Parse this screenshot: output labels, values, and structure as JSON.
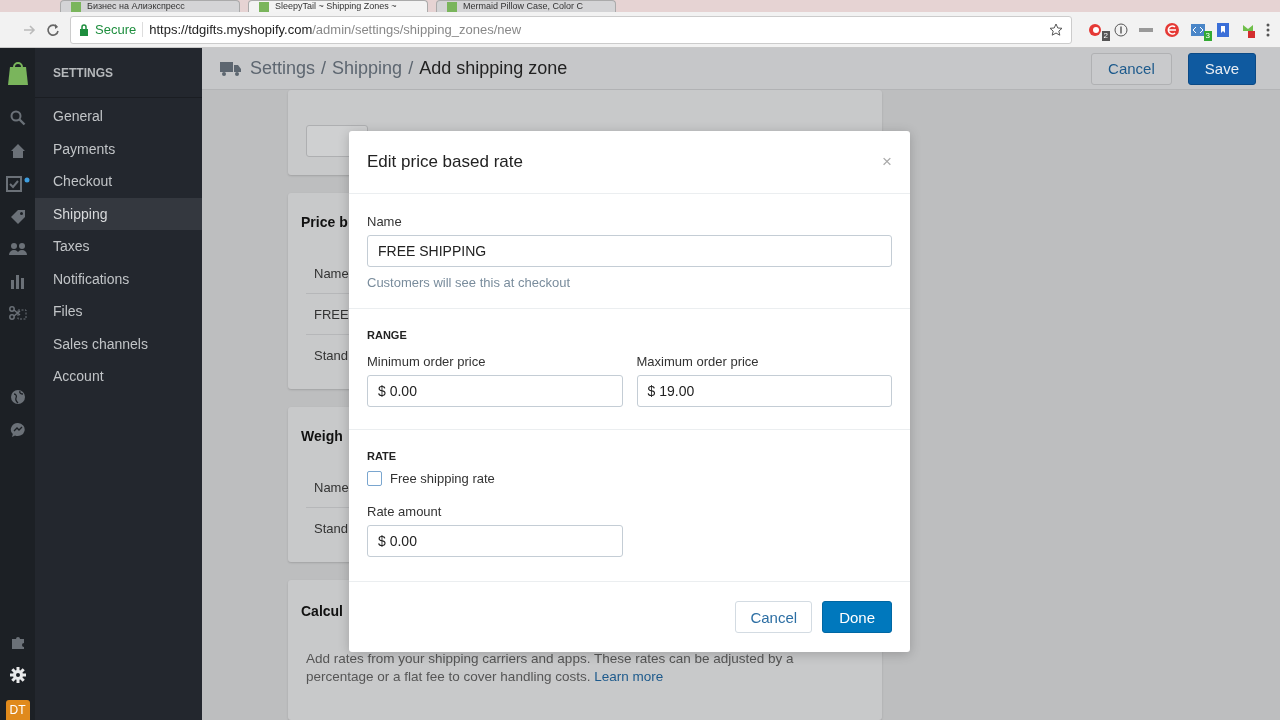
{
  "browser": {
    "tabs": [
      {
        "title": "Бизнес на Алиэкспресс",
        "selected": false
      },
      {
        "title": "SleepyTail ~ Shipping Zones ~",
        "selected": true
      },
      {
        "title": "Mermaid Pillow Case, Color C",
        "selected": false
      }
    ],
    "address": {
      "secure_label": "Secure",
      "url_host": "https://tdgifts.myshopify.com",
      "url_path": "/admin/settings/shipping_zones/new"
    },
    "extension_badges": [
      "2",
      "3"
    ]
  },
  "rail": {
    "avatar": "DT"
  },
  "sidebar": {
    "heading": "SETTINGS",
    "items": [
      {
        "label": "General",
        "selected": false
      },
      {
        "label": "Payments",
        "selected": false
      },
      {
        "label": "Checkout",
        "selected": false
      },
      {
        "label": "Shipping",
        "selected": true
      },
      {
        "label": "Taxes",
        "selected": false
      },
      {
        "label": "Notifications",
        "selected": false
      },
      {
        "label": "Files",
        "selected": false
      },
      {
        "label": "Sales channels",
        "selected": false
      },
      {
        "label": "Account",
        "selected": false
      }
    ]
  },
  "header": {
    "breadcrumbs": [
      {
        "label": "Settings",
        "separator": "/"
      },
      {
        "label": "Shipping",
        "separator": "/"
      }
    ],
    "title": "Add shipping zone",
    "cancel": "Cancel",
    "save": "Save"
  },
  "cards": [
    {
      "kind": "field"
    },
    {
      "kind": "table",
      "title": "Price b",
      "rows": [
        "Name",
        "FREE",
        "Stand"
      ]
    },
    {
      "kind": "table",
      "title": "Weigh",
      "rows": [
        "Name",
        "Stand"
      ]
    },
    {
      "kind": "text",
      "title": "Calcul",
      "text": "Add rates from your shipping carriers and apps. These rates can be adjusted by a percentage or a flat fee to cover handling costs.",
      "link": "Learn more"
    }
  ],
  "modal": {
    "title": "Edit price based rate",
    "close": "×",
    "name": {
      "label": "Name",
      "value": "FREE SHIPPING",
      "help": "Customers will see this at checkout"
    },
    "range": {
      "heading": "RANGE",
      "min": {
        "label": "Minimum order price",
        "value": "$ 0.00"
      },
      "max": {
        "label": "Maximum order price",
        "value": "$ 19.00"
      }
    },
    "rate": {
      "heading": "RATE",
      "free": {
        "label": "Free shipping rate",
        "checked": false
      },
      "amount": {
        "label": "Rate amount",
        "value": "$ 0.00"
      }
    },
    "cancel": "Cancel",
    "done": "Done"
  }
}
